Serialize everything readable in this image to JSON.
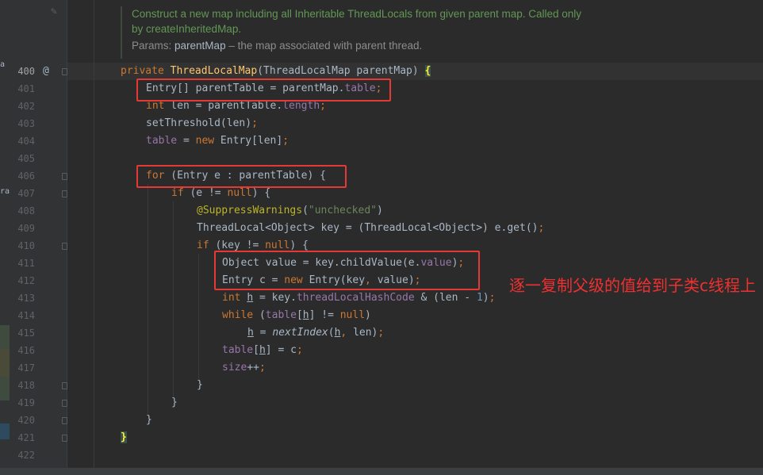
{
  "left_strip": {
    "labels": [
      "a",
      "ran"
    ]
  },
  "gutter": {
    "annotation_marker": "@"
  },
  "doc_comment": {
    "line1": "Construct a new map including all Inheritable ThreadLocals from given parent map. Called only",
    "line2": "by createInheritedMap.",
    "params_label": "Params:",
    "param_name": "parentMap",
    "param_desc": " – the map associated with parent thread."
  },
  "line_numbers": [
    "400",
    "401",
    "402",
    "403",
    "404",
    "405",
    "406",
    "407",
    "408",
    "409",
    "410",
    "411",
    "412",
    "413",
    "414",
    "415",
    "416",
    "417",
    "418",
    "419",
    "420",
    "421",
    "422"
  ],
  "code": {
    "l400": {
      "private": "private ",
      "name": "ThreadLocalMap",
      "params": "(ThreadLocalMap parentMap) ",
      "brace": "{"
    },
    "l401": {
      "a": "Entry[] parentTable = parentMap.",
      "field": "table",
      "semi": ";"
    },
    "l402": {
      "int": "int",
      "a": " len = parentTable.",
      "field": "length",
      "semi": ";"
    },
    "l403": {
      "a": "setThreshold(len)",
      "semi": ";"
    },
    "l404": {
      "field": "table",
      "a": " = ",
      "new": "new",
      "b": " Entry[len]",
      "semi": ";"
    },
    "l406": {
      "for": "for",
      "a": " (Entry e : parentTable) {"
    },
    "l407": {
      "if": "if",
      "a": " (e != ",
      "null": "null",
      "b": ") {"
    },
    "l408": {
      "ann": "@SuppressWarnings",
      "a": "(",
      "str": "\"unchecked\"",
      "b": ")"
    },
    "l409": {
      "a": "ThreadLocal<Object> key = (ThreadLocal<Object>) e.get()",
      "semi": ";"
    },
    "l410": {
      "if": "if",
      "a": " (key != ",
      "null": "null",
      "b": ") {"
    },
    "l411": {
      "a": "Object value = key.childValue(e.",
      "field": "value",
      "b": ")",
      "semi": ";"
    },
    "l412": {
      "a": "Entry c = ",
      "new": "new",
      "b": " Entry(key",
      "comma": ",",
      "c": " value)",
      "semi": ";"
    },
    "l413": {
      "int": "int",
      "sp": " ",
      "h": "h",
      "a": " = key.",
      "field": "threadLocalHashCode",
      "b": " & (len - ",
      "one": "1",
      "c": ")",
      "semi": ";"
    },
    "l414": {
      "while": "while",
      "a": " (",
      "table": "table",
      "b": "[",
      "h": "h",
      "c": "] != ",
      "null": "null",
      "d": ")"
    },
    "l415": {
      "h": "h",
      "a": " = ",
      "fn": "nextIndex",
      "b": "(",
      "h2": "h",
      "comma": ",",
      "c": " len)",
      "semi": ";"
    },
    "l416": {
      "table": "table",
      "a": "[",
      "h": "h",
      "b": "] = c",
      "semi": ";"
    },
    "l417": {
      "size": "size",
      "a": "++",
      "semi": ";"
    },
    "l418": {
      "a": "}"
    },
    "l419": {
      "a": "}"
    },
    "l420": {
      "a": "}"
    },
    "l421": {
      "brace": "}"
    }
  },
  "annotation_text": "逐一复制父级的值给到子类c线程上",
  "colors": {
    "background": "#2b2b2b",
    "keyword": "#cc7832",
    "method_decl": "#ffc66d",
    "field": "#9876aa",
    "string": "#6a8759",
    "annotation": "#bbb529",
    "doc": "#629755",
    "highlight_box": "#e53935",
    "note_text": "#f03030"
  }
}
